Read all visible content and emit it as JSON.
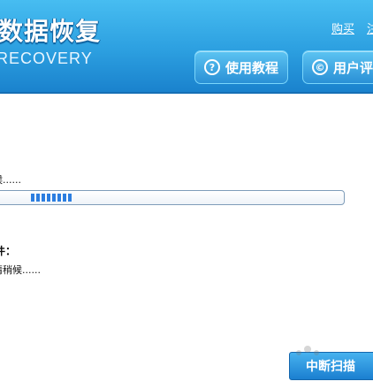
{
  "header": {
    "title": "数据恢复",
    "subtitle": "RECOVERY",
    "links": {
      "buy": "购买",
      "register": "注"
    },
    "buttons": {
      "tutorial": "使用教程",
      "review": "用户评"
    },
    "icons": {
      "tutorial_icon": "?",
      "review_icon": "©"
    }
  },
  "status": {
    "line1": "候......",
    "line2": "件：",
    "line3": "请稍候......"
  },
  "progress": {
    "value": 0.09
  },
  "footer": {
    "scan_button": "中断扫描"
  },
  "colors": {
    "header_top": "#47bdf1",
    "header_bottom": "#1a82cd",
    "accent": "#1b7fd0"
  }
}
